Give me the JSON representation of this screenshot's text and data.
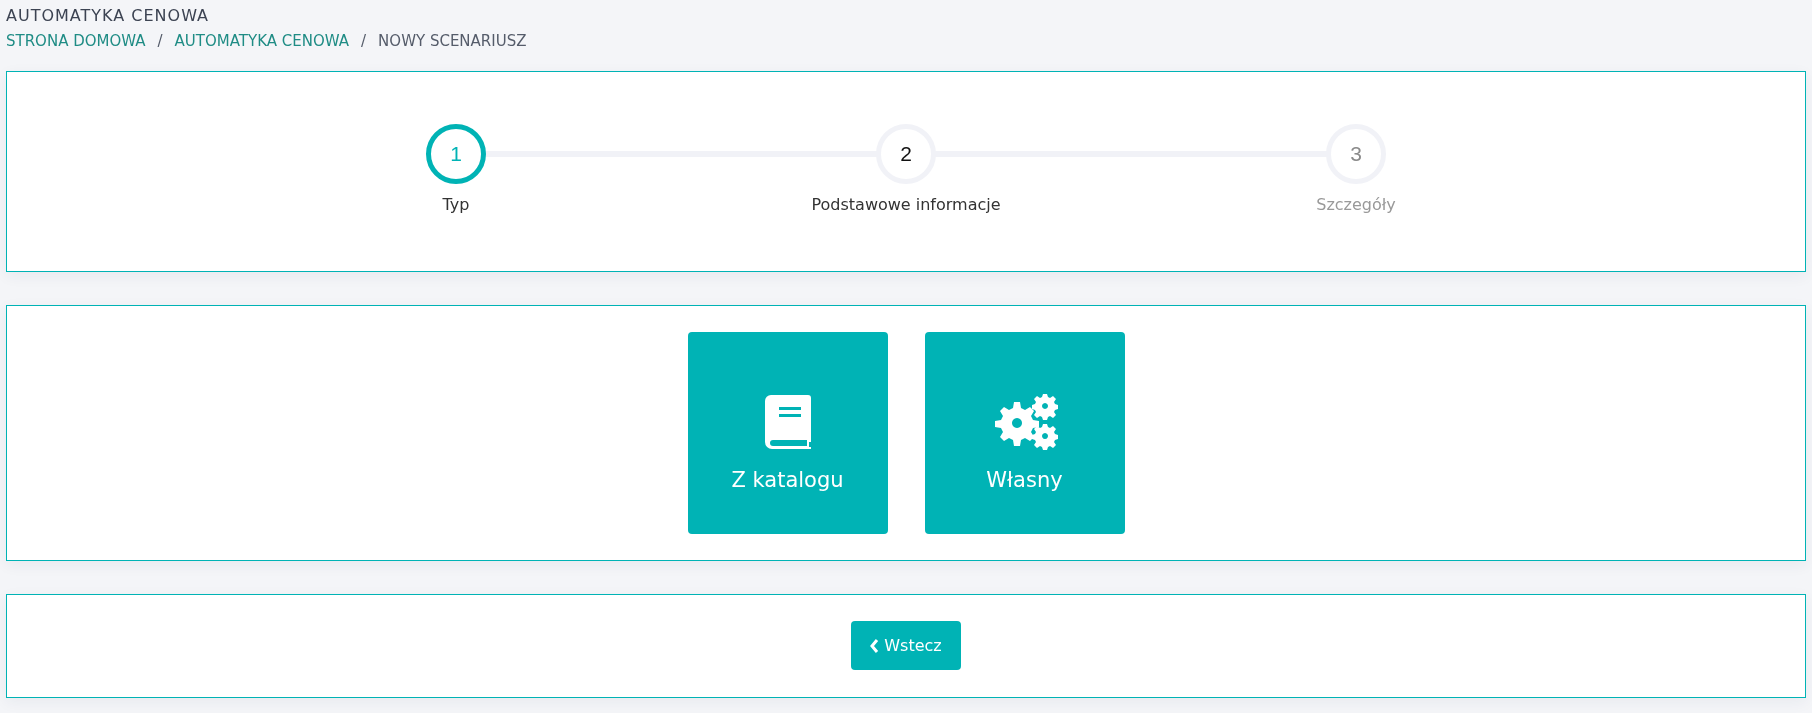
{
  "page_title": "AUTOMATYKA CENOWA",
  "breadcrumb": [
    {
      "label": "STRONA DOMOWA",
      "link": true
    },
    {
      "label": "AUTOMATYKA CENOWA",
      "link": true
    },
    {
      "label": "NOWY SCENARIUSZ",
      "link": false
    }
  ],
  "separator": "/",
  "steps": [
    {
      "number": "1",
      "label": "Typ",
      "selected": true,
      "disabled": false
    },
    {
      "number": "2",
      "label": "Podstawowe informacje",
      "selected": false,
      "disabled": false
    },
    {
      "number": "3",
      "label": "Szczegóły",
      "selected": false,
      "disabled": true
    }
  ],
  "options": [
    {
      "kind": "book",
      "label": "Z katalogu"
    },
    {
      "kind": "gears",
      "label": "Własny"
    }
  ],
  "back_button": {
    "label": "Wstecz"
  }
}
